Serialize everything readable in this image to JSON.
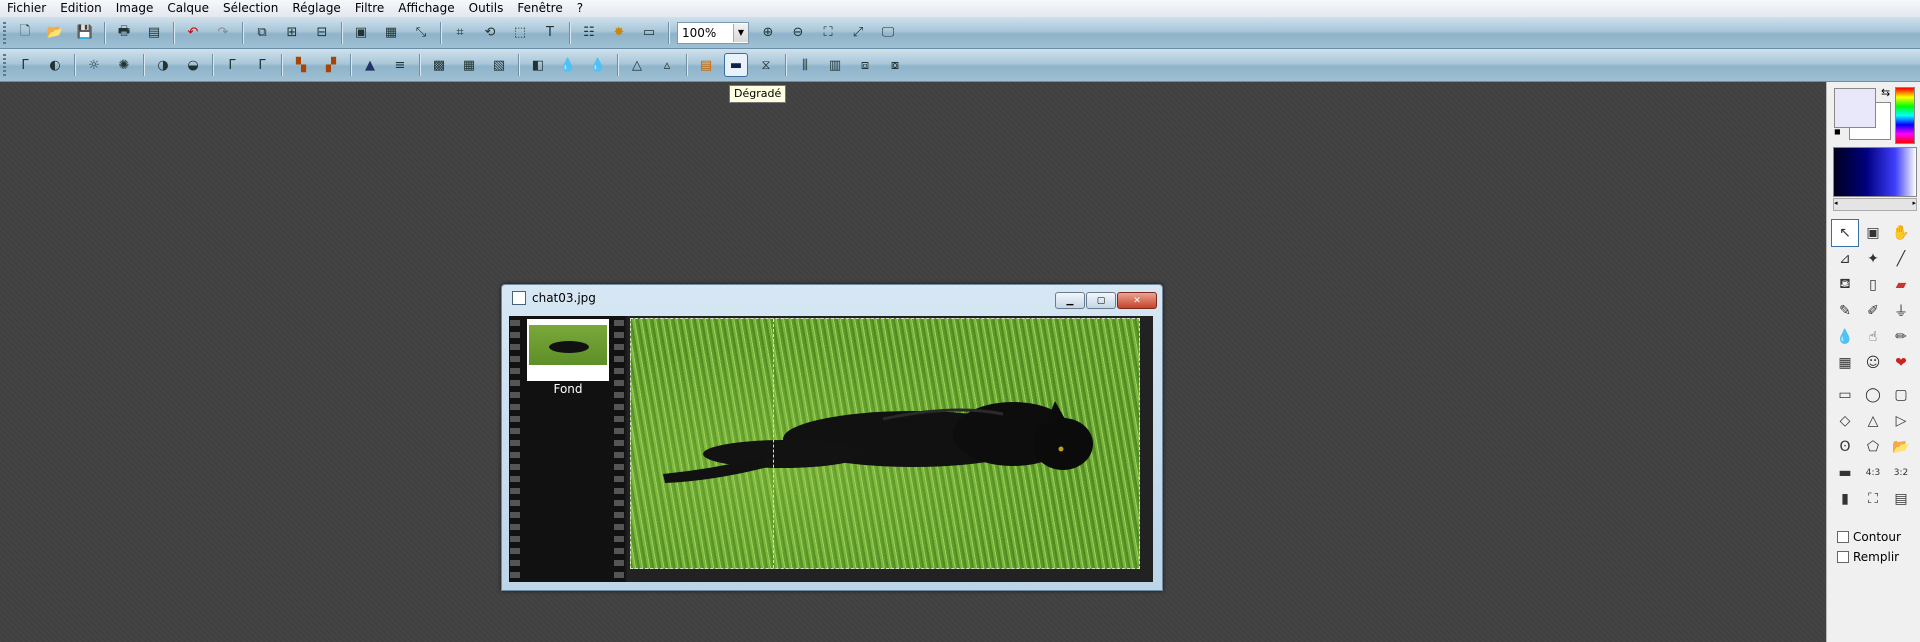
{
  "menu": [
    "Fichier",
    "Edition",
    "Image",
    "Calque",
    "Sélection",
    "Réglage",
    "Filtre",
    "Affichage",
    "Outils",
    "Fenêtre",
    "?"
  ],
  "toolbar": {
    "zoom_value": "100%",
    "icons_row1": [
      "new-file",
      "open-folder",
      "save",
      "print",
      "scan",
      "undo",
      "redo",
      "copy-layer",
      "paste-layer",
      "merge-layer",
      "frame",
      "color-grid",
      "resize",
      "crop",
      "rotate",
      "select",
      "text",
      "layers",
      "brightness",
      "window",
      "zoom-in",
      "zoom-out",
      "fit",
      "fit-window",
      "fullscreen"
    ],
    "icons_row2": [
      "auto-levels",
      "auto-contrast",
      "brightness-down",
      "brightness-up",
      "contrast-down",
      "contrast-up",
      "gamma-down",
      "gamma-up",
      "color-balance",
      "color-balance-2",
      "histogram",
      "equalize",
      "mosaic",
      "grid",
      "grid-2",
      "flip",
      "drop",
      "drop-2",
      "sharpen",
      "sharpen-2",
      "rainbow",
      "gradient",
      "transform",
      "split",
      "tile",
      "stack",
      "stack-2"
    ]
  },
  "tooltip": "Dégradé",
  "document": {
    "title": "chat03.jpg",
    "layer_name": "Fond"
  },
  "right_panel": {
    "fg_color": "#e8e8fa",
    "bg_color": "#ffffff",
    "contour_label": "Contour",
    "remplir_label": "Remplir"
  }
}
